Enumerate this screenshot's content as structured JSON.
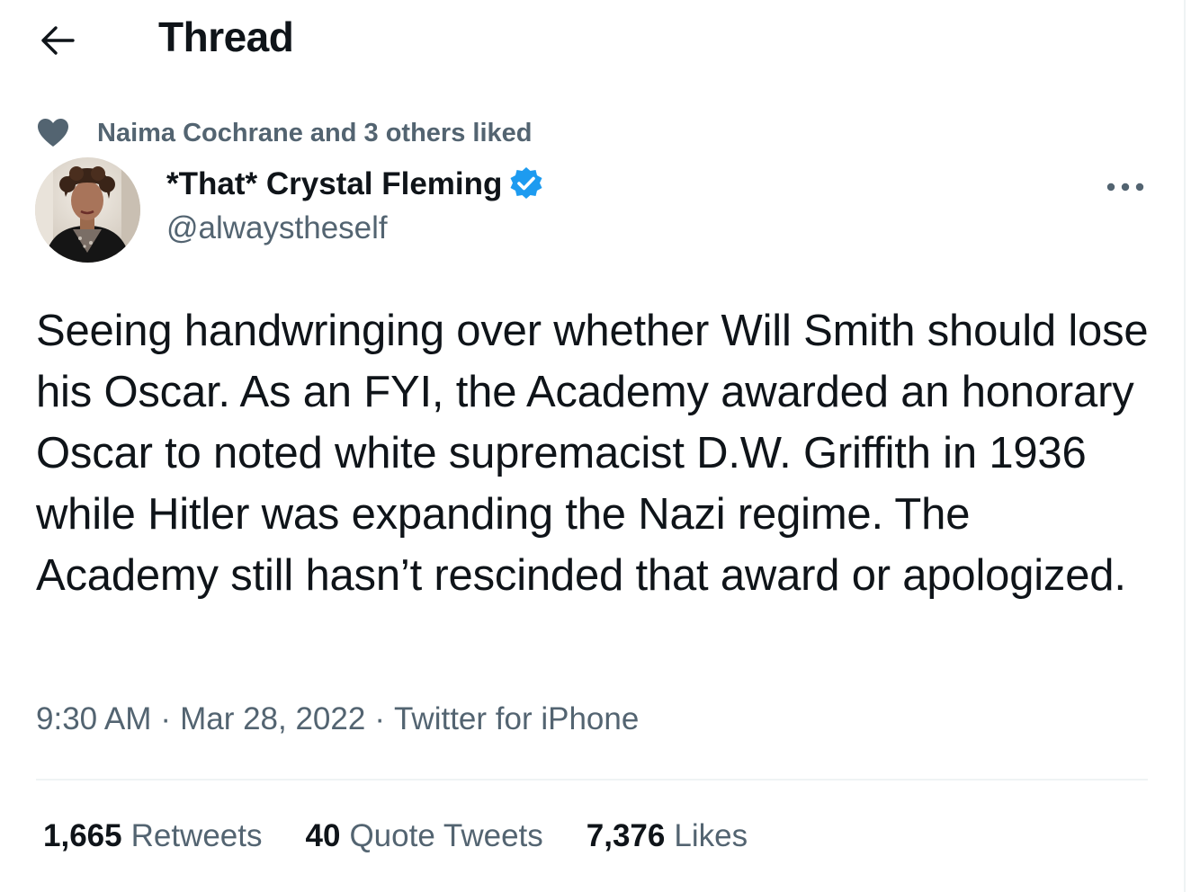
{
  "header": {
    "title": "Thread",
    "back_icon": "arrow-left-icon"
  },
  "social_context": {
    "icon": "heart-icon",
    "text": "Naima Cochrane and 3 others liked"
  },
  "author": {
    "name": "*That* Crystal Fleming",
    "handle": "@alwaystheself",
    "verified": true
  },
  "tweet": {
    "text": "Seeing handwringing over whether Will Smith should lose his Oscar. As an FYI, the Academy awarded an honorary Oscar to noted white supremacist D.W. Griffith in 1936 while Hitler was expanding the Nazi regime. The Academy still hasn’t rescinded that award or apologized.",
    "time": "9:30 AM",
    "date": "Mar 28, 2022",
    "source": "Twitter for iPhone",
    "separator": "·"
  },
  "stats": {
    "retweets_count": "1,665",
    "retweets_label": "Retweets",
    "quotes_count": "40",
    "quotes_label": "Quote Tweets",
    "likes_count": "7,376",
    "likes_label": "Likes"
  },
  "colors": {
    "text_primary": "#0f1419",
    "text_secondary": "#536471",
    "verified_blue": "#1d9bf0",
    "divider": "#eff3f4"
  }
}
